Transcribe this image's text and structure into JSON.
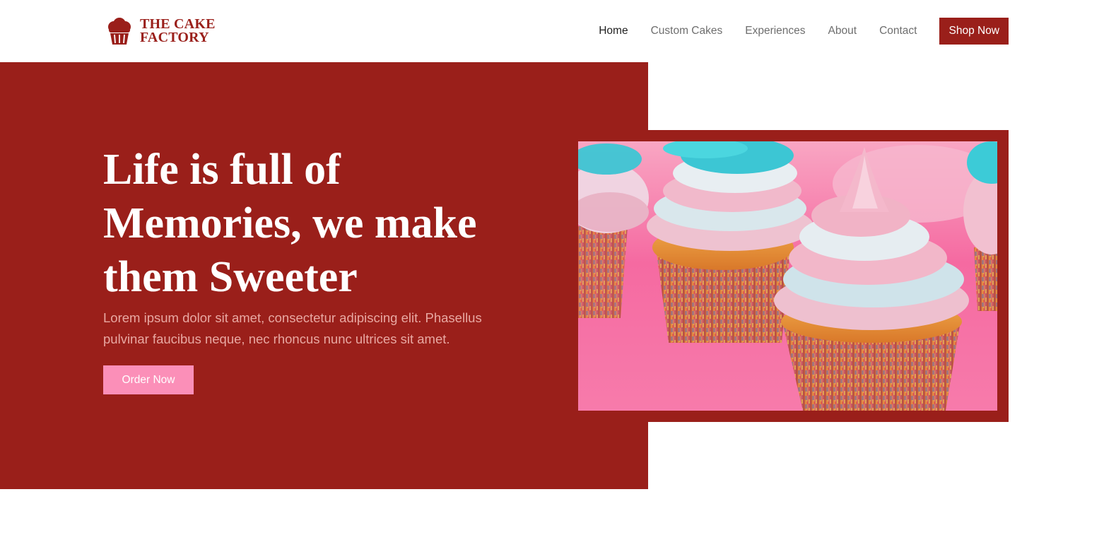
{
  "brand": {
    "line1": "THE CAKE",
    "line2": "FACTORY",
    "icon": "cupcake-icon",
    "color": "#9a1f1a"
  },
  "nav": {
    "items": [
      {
        "label": "Home",
        "active": true
      },
      {
        "label": "Custom Cakes",
        "active": false
      },
      {
        "label": "Experiences",
        "active": false
      },
      {
        "label": "About",
        "active": false
      },
      {
        "label": "Contact",
        "active": false
      }
    ],
    "cta_label": "Shop Now"
  },
  "hero": {
    "title_line1": "Life is full of",
    "title_line2": "Memories, we make",
    "title_line3": "them Sweeter",
    "description_line1": "Lorem ipsum dolor sit amet, consectetur adipiscing elit. Phasellus",
    "description_line2": "pulvinar faucibus neque, nec rhoncus nunc ultrices sit amet.",
    "button_label": "Order Now",
    "image": "cupcakes-photo"
  },
  "colors": {
    "primary": "#9a1f1a",
    "accent_pink": "#fb8fb8",
    "text_muted": "#e8a8a2"
  }
}
